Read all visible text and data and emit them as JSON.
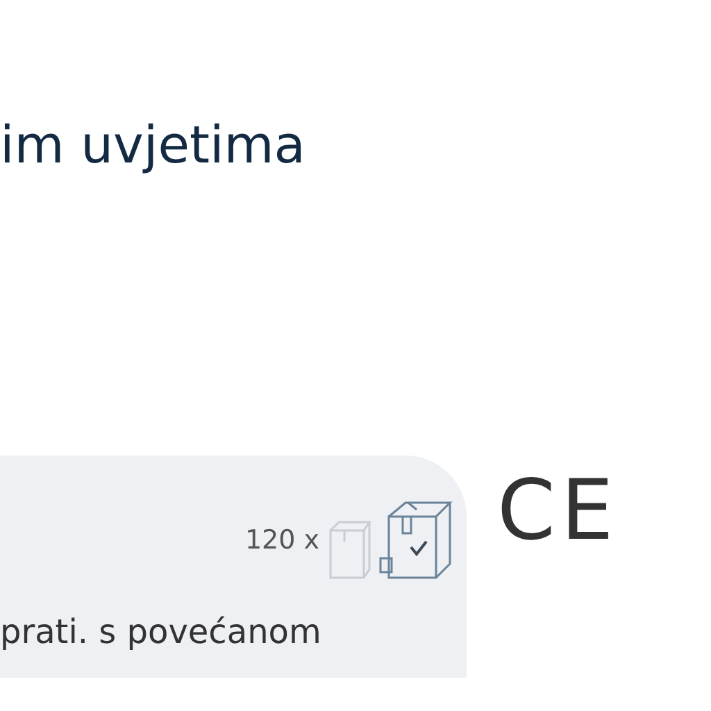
{
  "heading": "im uvjetima",
  "packaging": {
    "quantity": "120 x"
  },
  "certification": {
    "mark": "CE"
  },
  "description": "prati. s povećanom"
}
